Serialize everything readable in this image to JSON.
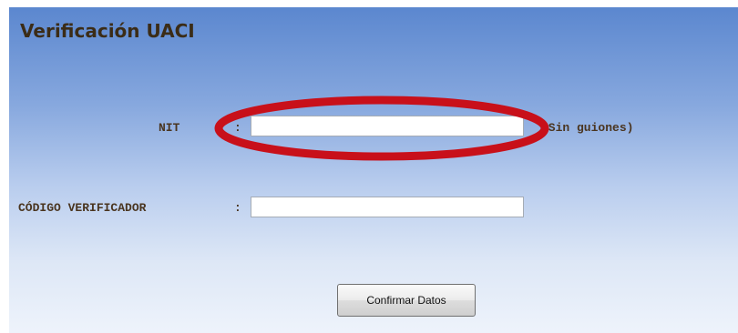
{
  "page": {
    "title": "Verificación UACI"
  },
  "form": {
    "nit": {
      "label": "NIT",
      "colon": ":",
      "value": "",
      "hint": "(Sin guiones)"
    },
    "codigo": {
      "label": "CÓDIGO VERIFICADOR",
      "colon": ":",
      "value": ""
    },
    "submit_label": "Confirmar Datos"
  },
  "annotation": {
    "color": "#c8101a"
  }
}
